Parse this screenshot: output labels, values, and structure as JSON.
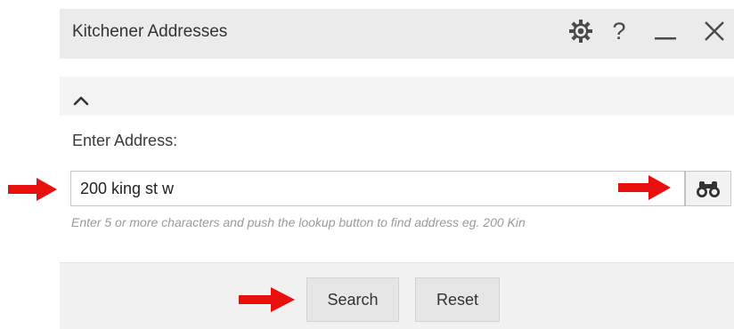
{
  "window": {
    "title": "Kitchener Addresses",
    "help_label": "?"
  },
  "form": {
    "address_label": "Enter Address:",
    "address_value": "200 king st w",
    "hint": "Enter 5 or more characters and push the lookup button to find address eg. 200 Kin"
  },
  "actions": {
    "search_label": "Search",
    "reset_label": "Reset"
  },
  "icons": {
    "settings": "gear-icon",
    "help": "question-mark-icon",
    "minimize": "minimize-icon",
    "close": "close-icon",
    "collapse": "chevron-up-icon",
    "lookup": "binoculars-icon",
    "annotation": "red-arrow-icon"
  },
  "colors": {
    "annotation_arrow": "#e8100d",
    "title_bar": "#ebebeb",
    "footer": "#f1f1f1"
  }
}
